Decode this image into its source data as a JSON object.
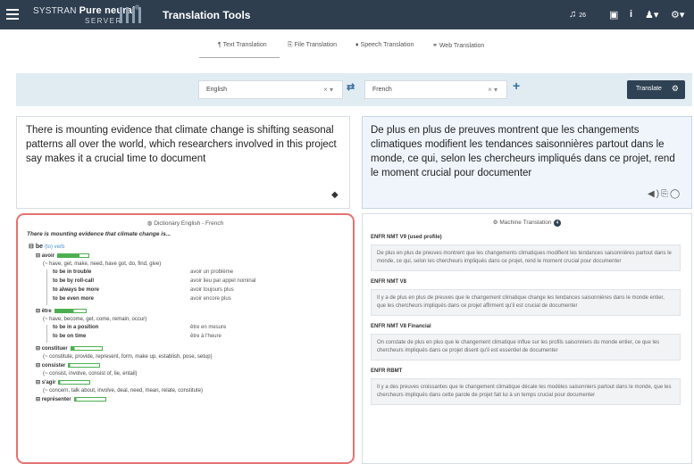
{
  "header": {
    "brand": "SYSTRAN",
    "brand_bold": "Pure neural",
    "brand_sup": "®",
    "brand_sub": "SERVER",
    "title": "Translation Tools",
    "bell_count": "26"
  },
  "tabs": [
    {
      "label": "Text Translation",
      "icon": "paragraph-icon"
    },
    {
      "label": "File Translation",
      "icon": "file-icon"
    },
    {
      "label": "Speech Translation",
      "icon": "mic-icon"
    },
    {
      "label": "Web Translation",
      "icon": "link-icon"
    }
  ],
  "source_lang": "English",
  "target_lang": "French",
  "translate_label": "Translate",
  "source_text": "There is mounting evidence that climate change is shifting seasonal patterns all over the world, which researchers involved in this project say makes it a crucial time to document",
  "target_text": "De plus en plus de preuves montrent que les changements climatiques modifient les tendances saisonnières partout dans le monde, ce qui, selon les chercheurs impliqués dans ce projet, rend le moment crucial pour documenter",
  "dictionary": {
    "title": "Dictionary English - French",
    "context": "There is mounting evidence that climate change is...",
    "lemma": "be",
    "lemma_pos": "(to) verb",
    "s1": {
      "word": "avoir",
      "freq": 70,
      "syn": "(~ have, get, make, need, have got, do, find, give)",
      "phrases": [
        {
          "src": "to be in trouble",
          "tgt": "avoir un problème"
        },
        {
          "src": "to be by roll-call",
          "tgt": "avoir lieu par appel nominal"
        },
        {
          "src": "to always be more",
          "tgt": "avoir toujours plus"
        },
        {
          "src": "to be even more",
          "tgt": "avoir encore plus"
        }
      ]
    },
    "s2": {
      "word": "être",
      "freq": 60,
      "syn": "(~ have, become, get, come, remain, occur)",
      "phrases": [
        {
          "src": "to be in a position",
          "tgt": "être en mesure"
        },
        {
          "src": "to be on time",
          "tgt": "être à l'heure"
        }
      ]
    },
    "s3": {
      "word": "constituer",
      "freq": 10,
      "syn": "(~ constitute, provide, represent, form, make up, establish, pose, setup)"
    },
    "s4": {
      "word": "consister",
      "freq": 4,
      "syn": "(~ consist, involve, consist of, lie, entail)"
    },
    "s5": {
      "word": "s'agir",
      "freq": 4,
      "syn": "(~ concern, talk about, involve, deal, need, mean, relate, constitute)"
    },
    "s6": {
      "word": "représenter",
      "freq": 4
    }
  },
  "machine": {
    "title": "Machine Translation",
    "count": "4",
    "engines": [
      {
        "name": "ENFR NMT V9 (used profile)",
        "text": "De plus en plus de preuves montrent que les changements climatiques modifient les tendances saisonnières partout dans le monde, ce qui, selon les chercheurs impliqués dans ce projet, rend le moment crucial pour documenter"
      },
      {
        "name": "ENFR NMT V8",
        "text": "Il y a de plus en plus de preuves que le changement climatique change les tendances saisonnières dans le monde entier, que les chercheurs impliqués dans ce projet affirment qu'il est crucial de documenter"
      },
      {
        "name": "ENFR NMT V8 Financial",
        "text": "On constate de plus en plus que le changement climatique influe sur les profils saisonniers du monde entier, ce que les chercheurs impliqués dans ce projet disent qu'il est essentiel de documenter"
      },
      {
        "name": "ENFR RBMT",
        "text": "Il y a des preuves croissantes que le changement climatique décale les modèles saisonniers partout dans le monde, que les chercheurs impliqués dans cette parole de projet fait lui à un temps crucial pour documenter"
      }
    ]
  }
}
